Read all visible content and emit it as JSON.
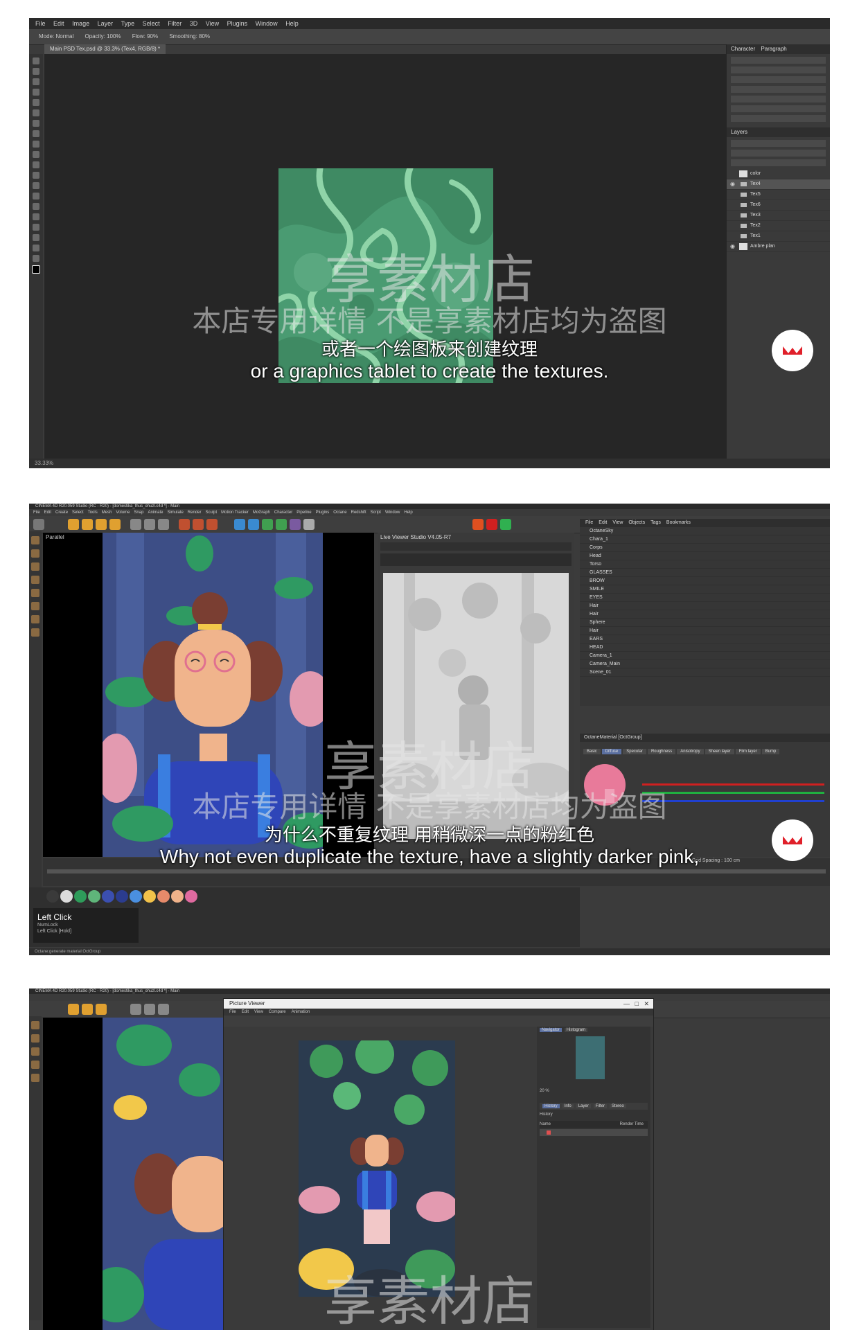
{
  "watermark": {
    "big": "享素材店",
    "small": "本店专用详情 不是享素材店均为盗图"
  },
  "frame1": {
    "menu": [
      "File",
      "Edit",
      "Image",
      "Layer",
      "Type",
      "Select",
      "Filter",
      "3D",
      "View",
      "Plugins",
      "Window",
      "Help"
    ],
    "options": [
      "Mode: Normal",
      "Opacity: 100%",
      "Flow: 90%",
      "Smoothing: 80%"
    ],
    "doc_tab": "Main PSD Tex.psd @ 33.3% (Tex4, RGB/8) *",
    "panel_tabs": [
      "Character",
      "Paragraph"
    ],
    "layers_title": "Layers",
    "layers": [
      {
        "name": "color",
        "type": "thumb",
        "selected": false
      },
      {
        "name": "Tex4",
        "type": "folder",
        "selected": true
      },
      {
        "name": "Tex5",
        "type": "folder",
        "selected": false
      },
      {
        "name": "Tex6",
        "type": "folder",
        "selected": false
      },
      {
        "name": "Tex3",
        "type": "folder",
        "selected": false
      },
      {
        "name": "Tex2",
        "type": "folder",
        "selected": false
      },
      {
        "name": "Tex1",
        "type": "folder",
        "selected": false
      },
      {
        "name": "Ambre plan",
        "type": "thumb",
        "selected": false
      }
    ],
    "status": "33.33%",
    "subtitle_zh": "或者一个绘图板来创建纹理",
    "subtitle_en": "or a graphics tablet to create the textures."
  },
  "frame2": {
    "title": "CINEMA 4D R20.059 Studio (RC - R20) - [domestika_thus_ohuzl.c4d *] - Main",
    "menu": [
      "File",
      "Edit",
      "Create",
      "Select",
      "Tools",
      "Mesh",
      "Volume",
      "Snap",
      "Animate",
      "Simulate",
      "Render",
      "Sculpt",
      "Motion Tracker",
      "MoGraph",
      "Character",
      "Pipeline",
      "Plugins",
      "Octane",
      "Redshift",
      "Script",
      "Window",
      "Help"
    ],
    "viewport_label": "Parallel",
    "render_title": "Live Viewer Studio V4.05-R7",
    "objects_tabs": [
      "File",
      "Edit",
      "View",
      "Objects",
      "Tags",
      "Bookmarks"
    ],
    "objects": [
      "OctaneSky",
      "Chara_1",
      "Corps",
      "Head",
      "Torso",
      "GLASSES",
      "BROW",
      "SMILE",
      "EYES",
      "Hair",
      "Hair",
      "Sphere",
      "Hair",
      "EARS",
      "HEAD",
      "Camera_1",
      "Camera_Main",
      "Scene_01"
    ],
    "attr_title": "OctaneMaterial [OctGroup]",
    "attr_tabs": [
      "Basic",
      "Diffuse",
      "Specular",
      "Roughness",
      "Anisotropy",
      "Sheen layer",
      "Film layer",
      "Bump"
    ],
    "timeline_label": "Grid Spacing : 100 cm",
    "left_click": "Left Click",
    "left_click_sub": [
      "NumLock",
      "Left Click [Hold]"
    ],
    "status": "Octane:generate material:OctGroup",
    "subtitle_zh": "为什么不重复纹理 用稍微深一点的粉红色",
    "subtitle_en": "Why not even duplicate the texture, have a slightly darker pink,",
    "material_colors": [
      "#3a3a3a",
      "#dcdcdc",
      "#2e9c5a",
      "#5fb57a",
      "#3b4fb0",
      "#2b3c8f",
      "#4a8fe0",
      "#f2c24a",
      "#e68a6a",
      "#f0b28a",
      "#e06aa0"
    ]
  },
  "frame3": {
    "title": "CINEMA 4D R20.059 Studio (RC - R20) - [domestika_thus_ohuzl.c4d *] - Main",
    "viewer_title": "Picture Viewer",
    "viewer_menu": [
      "File",
      "Edit",
      "View",
      "Compare",
      "Animation"
    ],
    "side_tabs": [
      "Navigator",
      "Histogram"
    ],
    "history_tabs": [
      "History",
      "Info",
      "Layer",
      "Filter",
      "Stereo"
    ],
    "history_title": "History",
    "history_columns": [
      "Name",
      "Render Time"
    ],
    "zoom": "20 %"
  }
}
